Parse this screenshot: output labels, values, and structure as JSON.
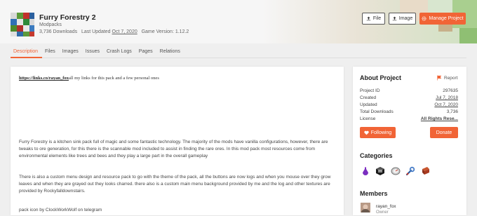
{
  "project": {
    "title": "Furry Forestry 2",
    "type": "Modpacks",
    "downloads": "3,736 Downloads",
    "updated_label": "Last Updated",
    "updated_value": "Oct 7, 2020",
    "game_version": "Game Version: 1.12.2"
  },
  "actions": {
    "file": "File",
    "image": "Image",
    "manage": "Manage Project"
  },
  "tabs": [
    "Description",
    "Files",
    "Images",
    "Issues",
    "Crash Logs",
    "Pages",
    "Relations"
  ],
  "description": {
    "link_text": "https://links.co/rayan_fox",
    "link_suffix": "all my links for this pack and a few personal ones",
    "para1": "Furry Forestry is a kitchen sink pack full of magic and some fantastic technology. The majority of the mods have vanilla configurations, however, there are tweaks to ore generation, for this there is the scannable mod included to assist in finding the rare ores. In this mod pack most resources come from environmental elements like trees and bees and they play a large part in the overall gameplay",
    "para2": "There is also a custom menu design and resource pack to go with the theme of the pack, all the buttons are now logs and when you mouse over they grow leaves and when they are grayed out they looks charred. there also is a custom main menu background provided by me and the log and other textures are provided by Rockyfalldownstairs.",
    "para3": "pack icon by ClockWorkWolf on telegram"
  },
  "about": {
    "heading": "About Project",
    "report": "Report",
    "rows": [
      {
        "label": "Project ID",
        "value": "297635"
      },
      {
        "label": "Created",
        "value": "Jul 7, 2018"
      },
      {
        "label": "Updated",
        "value": "Oct 7, 2020"
      },
      {
        "label": "Total Downloads",
        "value": "3,736"
      },
      {
        "label": "License",
        "value": "All Rights Rese..."
      }
    ],
    "following": "Following",
    "donate": "Donate"
  },
  "categories": {
    "heading": "Categories",
    "icons": [
      "magic-potion-icon",
      "cube-icon",
      "compass-icon",
      "wrench-icon",
      "book-icon"
    ]
  },
  "members": {
    "heading": "Members",
    "name": "rayan_fox",
    "role": "Owner"
  },
  "colors": {
    "accent": "#f16436"
  }
}
